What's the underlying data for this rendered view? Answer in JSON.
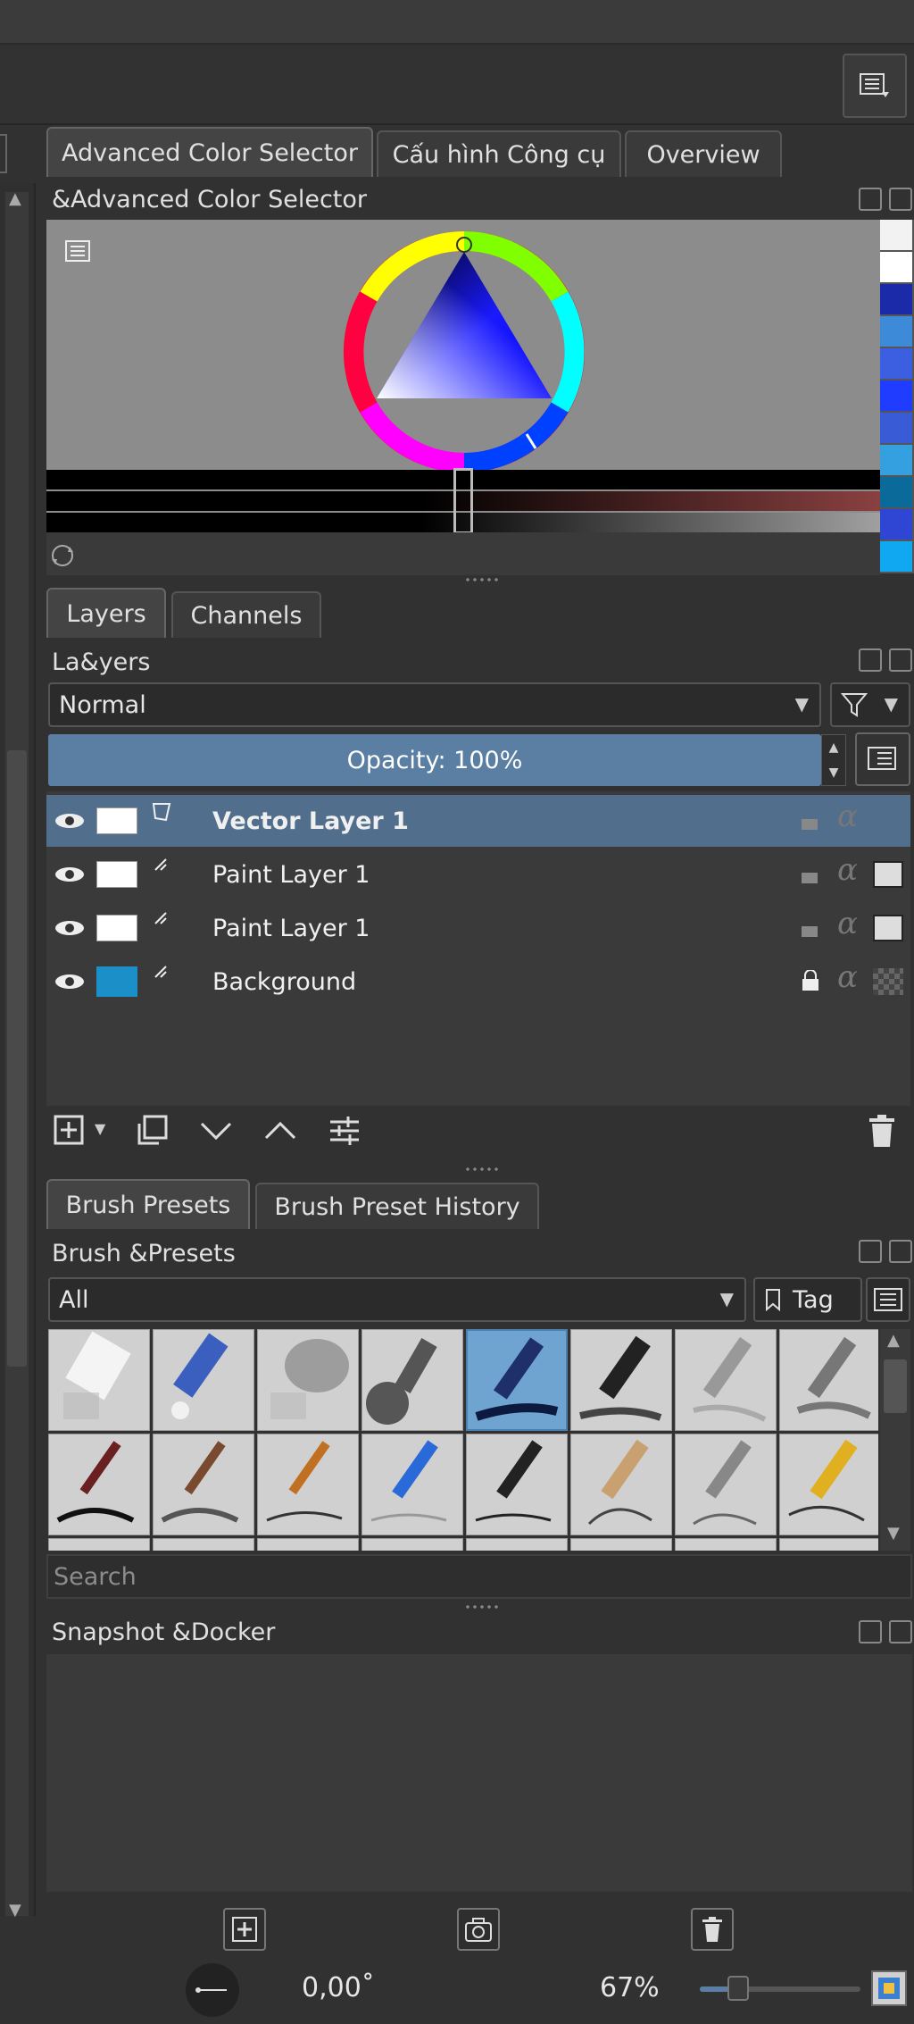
{
  "tabs_top": {
    "items": [
      {
        "label": "Advanced Color Selector"
      },
      {
        "label": "Cấu hình Công cụ"
      },
      {
        "label": "Overview"
      }
    ]
  },
  "color_selector": {
    "title": "&Advanced Color Selector",
    "swatches": [
      "#f2f2f2",
      "#ffffff",
      "#1a2aa8",
      "#3c8ad8",
      "#3b5fe0",
      "#1f3cff",
      "#3a5bd6",
      "#34a0e0",
      "#0a6a99",
      "#2f46d4",
      "#11a8f2"
    ]
  },
  "layers_tabs": {
    "items": [
      {
        "label": "Layers"
      },
      {
        "label": "Channels"
      }
    ]
  },
  "layers": {
    "title": "La&yers",
    "blend_mode": "Normal",
    "opacity": "Opacity:  100%",
    "rows": [
      {
        "name": "Vector Layer 1",
        "selected": true
      },
      {
        "name": "Paint Layer 1",
        "selected": false
      },
      {
        "name": "Paint Layer 1",
        "selected": false
      },
      {
        "name": "Background",
        "selected": false
      }
    ]
  },
  "brush_tabs": {
    "items": [
      {
        "label": "Brush Presets"
      },
      {
        "label": "Brush Preset History"
      }
    ]
  },
  "brush_presets": {
    "title": "Brush &Presets",
    "filter": "All",
    "tag_label": "Tag",
    "search_placeholder": "Search"
  },
  "snapshot": {
    "title": "Snapshot &Docker"
  },
  "status": {
    "rotation": "0,00˚",
    "zoom": "67%",
    "zoom_level": 0.2
  },
  "colors": {
    "accent_selected": "#516f8d",
    "opacity_bar": "#5a7fa2"
  }
}
